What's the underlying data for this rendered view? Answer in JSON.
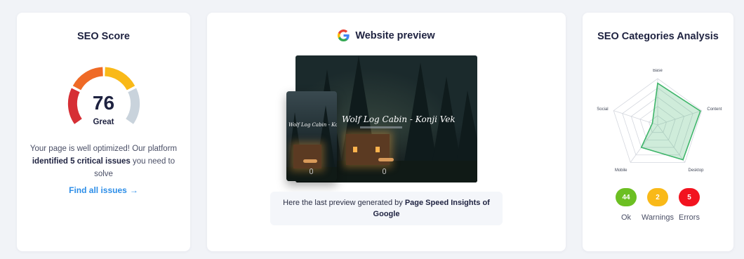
{
  "seo_score": {
    "title": "SEO Score",
    "value": "76",
    "max": 100,
    "rating": "Great",
    "desc_part1": "Your page is well optimized! Our platform ",
    "desc_bold": "identified 5 critical issues",
    "desc_part2": " you need to solve",
    "link_label": "Find all issues",
    "gauge_colors": [
      "#d62f35",
      "#ef6a26",
      "#f9b918",
      "#c9d3dc"
    ]
  },
  "website_preview": {
    "title": "Website preview",
    "icon": "google-icon",
    "site_title": "Wolf Log Cabin - Konji Vek",
    "caption_part1": "Here the last preview generated by ",
    "caption_bold": "Page Speed Insights of Google"
  },
  "seo_categories": {
    "title": "SEO Categories Analysis",
    "axes": [
      "Base",
      "Content",
      "Desktop",
      "Mobile",
      "Social"
    ],
    "values": [
      0.9,
      0.97,
      0.93,
      0.6,
      0.12
    ],
    "fill_color": "#3fb56a",
    "badges": [
      {
        "value": "44",
        "label": "Ok",
        "color": "#6cbf22"
      },
      {
        "value": "2",
        "label": "Warnings",
        "color": "#f9b918"
      },
      {
        "value": "5",
        "label": "Errors",
        "color": "#f2131f"
      }
    ]
  }
}
